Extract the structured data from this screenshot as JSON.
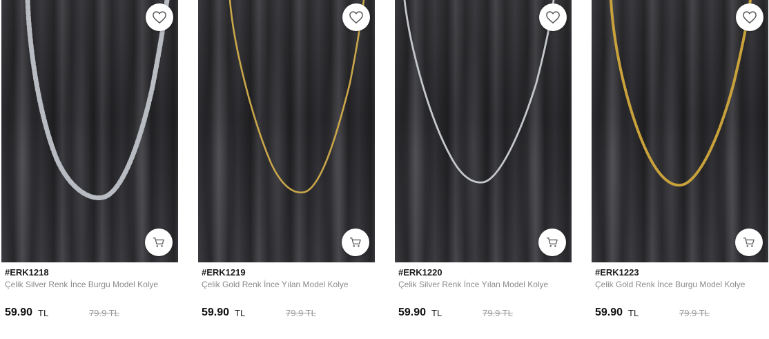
{
  "products": [
    {
      "code": "#ERK1218",
      "name": "Çelik Silver Renk İnce Burgu Model Kolye",
      "price": "59.90",
      "currency": "TL",
      "old_price": "79.9 TL",
      "chain_color": "#b8bcc2",
      "chain_style": "box",
      "favorite_icon": "heart-icon",
      "cart_icon": "cart-icon"
    },
    {
      "code": "#ERK1219",
      "name": "Çelik Gold Renk İnce Yılan Model Kolye",
      "price": "59.90",
      "currency": "TL",
      "old_price": "79.9 TL",
      "chain_color": "#c9a64a",
      "chain_style": "snake",
      "favorite_icon": "heart-icon",
      "cart_icon": "cart-icon"
    },
    {
      "code": "#ERK1220",
      "name": "Çelik Silver Renk İnce Yılan Model Kolye",
      "price": "59.90",
      "currency": "TL",
      "old_price": "79.9 TL",
      "chain_color": "#c4c7cc",
      "chain_style": "snake",
      "favorite_icon": "heart-icon",
      "cart_icon": "cart-icon"
    },
    {
      "code": "#ERK1223",
      "name": "Çelik Gold Renk İnce Burgu Model Kolye",
      "price": "59.90",
      "currency": "TL",
      "old_price": "79.9 TL",
      "chain_color": "#c9a23c",
      "chain_style": "rope",
      "favorite_icon": "heart-icon",
      "cart_icon": "cart-icon"
    }
  ]
}
